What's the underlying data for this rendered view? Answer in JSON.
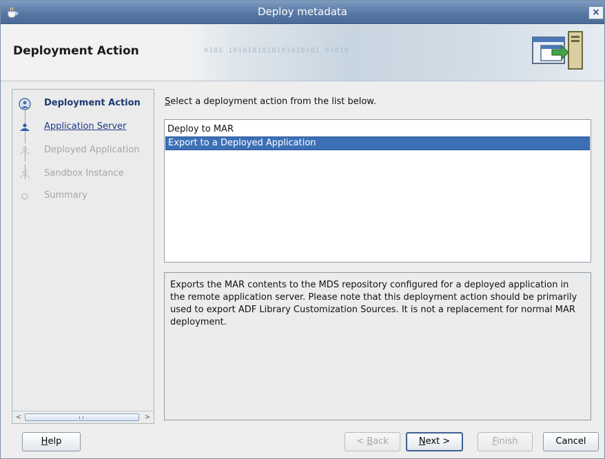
{
  "window": {
    "title": "Deploy metadata",
    "close_label": "×"
  },
  "header": {
    "title": "Deployment Action",
    "banner_text": "0101 1010101010101010101 01010",
    "icon": "wizard-deploy-icon"
  },
  "nav": {
    "items": [
      {
        "label": "Deployment Action",
        "state": "current"
      },
      {
        "label": "Application Server",
        "state": "link"
      },
      {
        "label": "Deployed Application",
        "state": "disabled"
      },
      {
        "label": "Sandbox Instance",
        "state": "disabled"
      },
      {
        "label": "Summary",
        "state": "disabled"
      }
    ],
    "scroll_left": "<",
    "scroll_right": ">"
  },
  "main": {
    "prompt_mnemonic": "S",
    "prompt_rest": "elect a deployment action from the list below.",
    "actions": [
      {
        "label": "Deploy to MAR",
        "selected": false
      },
      {
        "label": "Export to a Deployed Application",
        "selected": true
      }
    ],
    "description": "Exports the MAR contents to the MDS repository configured for a deployed application in the remote application server. Please note that this deployment action should be primarily used to export ADF Library Customization Sources. It is not a replacement for normal MAR deployment."
  },
  "buttons": {
    "help": {
      "mnemonic": "H",
      "rest": "elp"
    },
    "back": {
      "prefix": "< ",
      "mnemonic": "B",
      "rest": "ack"
    },
    "next": {
      "mnemonic": "N",
      "rest": "ext >"
    },
    "finish": {
      "mnemonic": "F",
      "rest": "inish"
    },
    "cancel": {
      "label": "Cancel"
    }
  },
  "colors": {
    "titlebar": "#5878a3",
    "selection": "#3c70b6",
    "link": "#1d3a8a"
  }
}
